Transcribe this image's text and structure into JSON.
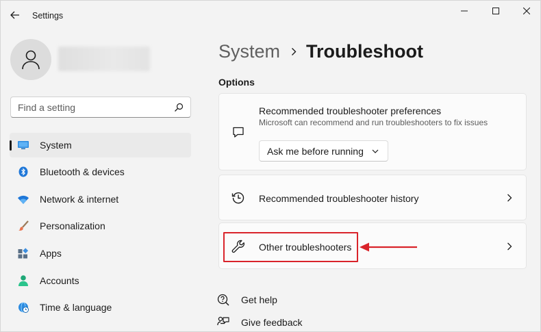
{
  "window": {
    "title": "Settings",
    "controls": [
      "minimize-icon",
      "maximize-icon",
      "close-icon"
    ]
  },
  "user": {
    "avatar_icon": "person-icon"
  },
  "search": {
    "placeholder": "Find a setting",
    "icon": "search-icon"
  },
  "sidebar": {
    "items": [
      {
        "label": "System",
        "icon": "monitor-icon",
        "selected": true
      },
      {
        "label": "Bluetooth & devices",
        "icon": "bluetooth-icon",
        "selected": false
      },
      {
        "label": "Network & internet",
        "icon": "wifi-icon",
        "selected": false
      },
      {
        "label": "Personalization",
        "icon": "paintbrush-icon",
        "selected": false
      },
      {
        "label": "Apps",
        "icon": "apps-icon",
        "selected": false
      },
      {
        "label": "Accounts",
        "icon": "accounts-icon",
        "selected": false
      },
      {
        "label": "Time & language",
        "icon": "globe-clock-icon",
        "selected": false
      }
    ]
  },
  "breadcrumb": {
    "parent": "System",
    "current": "Troubleshoot"
  },
  "options": {
    "heading": "Options",
    "preferences_card": {
      "title": "Recommended troubleshooter preferences",
      "subtitle": "Microsoft can recommend and run troubleshooters to fix issues",
      "icon": "chat-bubble-icon",
      "dropdown_value": "Ask me before running"
    },
    "history_card": {
      "title": "Recommended troubleshooter history",
      "icon": "history-icon"
    },
    "other_card": {
      "title": "Other troubleshooters",
      "icon": "wrench-icon"
    }
  },
  "footer": {
    "get_help": "Get help",
    "give_feedback": "Give feedback"
  },
  "colors": {
    "accent": "#0067c0",
    "annotation_red": "#d9232a",
    "background": "#f3f3f3",
    "card": "#fbfbfb"
  }
}
